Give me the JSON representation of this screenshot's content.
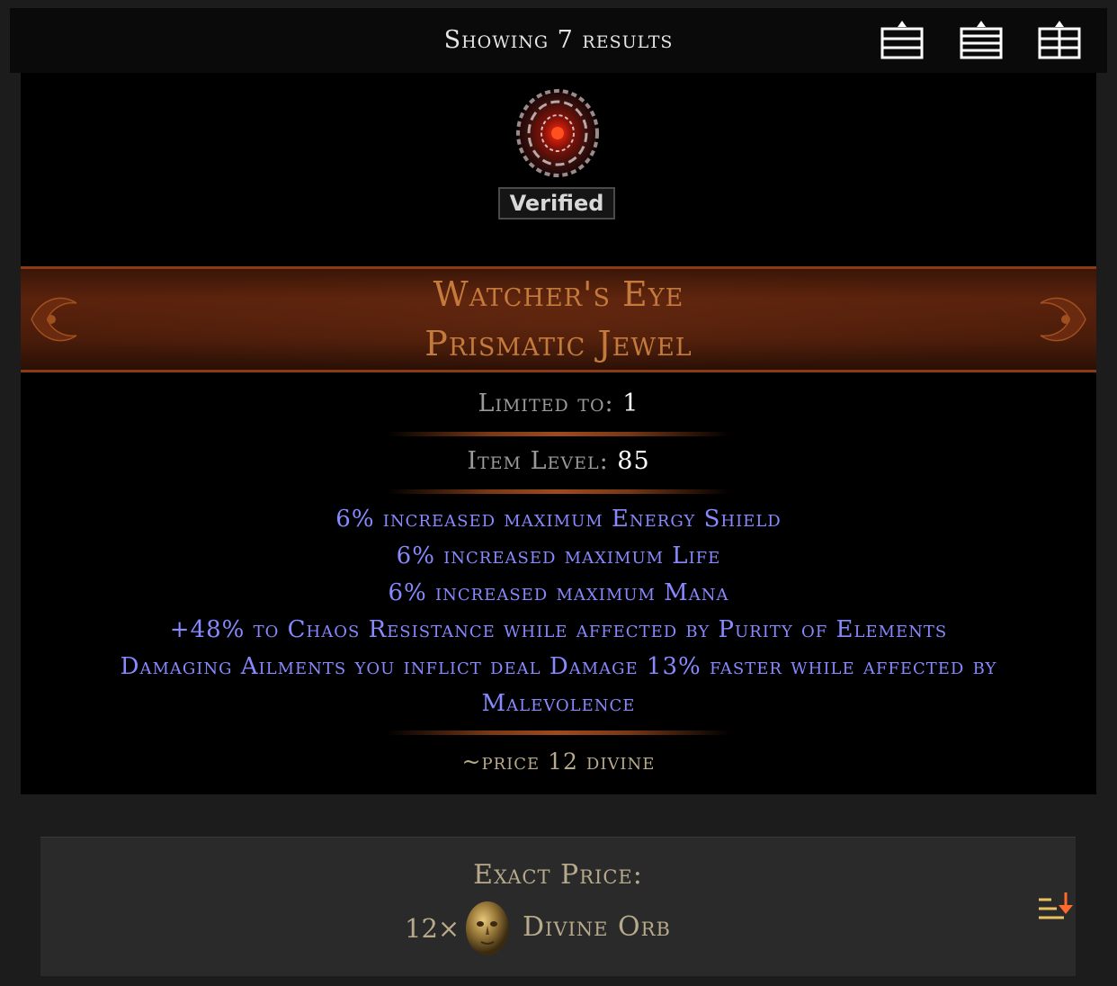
{
  "topbar": {
    "showing_text": "Showing 7 results",
    "layout_buttons": [
      "layout-compact-icon",
      "layout-list-icon",
      "layout-grid-icon"
    ]
  },
  "item": {
    "icon": "watchers-eye-jewel-icon",
    "verified": "Verified",
    "name": "Watcher's Eye",
    "base_type": "Prismatic Jewel",
    "limited_label": "Limited to:",
    "limited_value": "1",
    "ilvl_label": "Item Level:",
    "ilvl_value": "85",
    "mods": [
      "6% increased maximum Energy Shield",
      "6% increased maximum Life",
      "6% increased maximum Mana",
      "+48% to Chaos Resistance while affected by Purity of Elements",
      "Damaging Ailments you inflict deal Damage 13% faster while affected by",
      "Malevolence"
    ],
    "note": "~price 12 divine"
  },
  "price": {
    "label": "Exact Price:",
    "quantity": "12×",
    "currency": "Divine Orb",
    "currency_icon": "divine-orb-icon",
    "sort_icon": "sort-descending-icon"
  },
  "colors": {
    "unique_name": "#c37a3c",
    "magic_mod": "#8888ff",
    "property_label": "#9a9a9a",
    "note_text": "#b7a98b",
    "header_border": "#8a3a16"
  }
}
